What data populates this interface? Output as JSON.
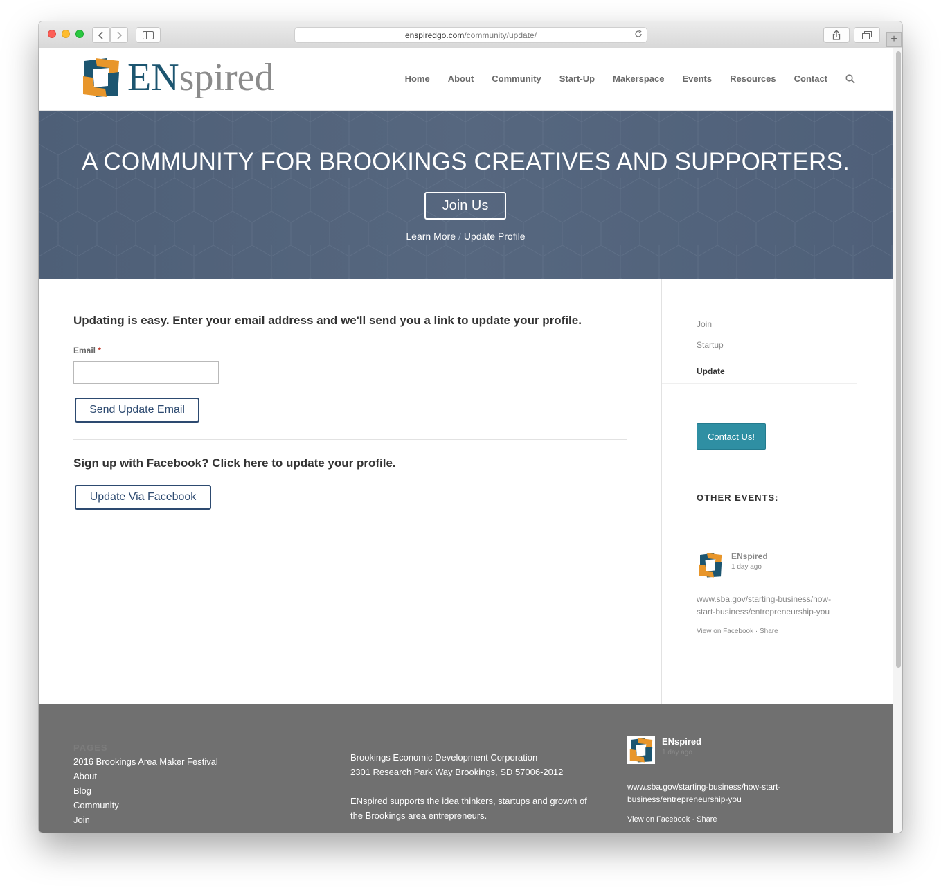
{
  "browser": {
    "url_domain": "enspiredgo.com",
    "url_path": "/community/update/"
  },
  "header": {
    "logo_en": "EN",
    "logo_rest": "spired",
    "nav": [
      "Home",
      "About",
      "Community",
      "Start-Up",
      "Makerspace",
      "Events",
      "Resources",
      "Contact"
    ]
  },
  "hero": {
    "title": "A COMMUNITY FOR BROOKINGS CREATIVES AND SUPPORTERS.",
    "join_button": "Join Us",
    "learn_more": "Learn More",
    "separator": "/",
    "update_profile": "Update Profile"
  },
  "main": {
    "intro": "Updating is easy. Enter your email address and we'll send you a link to update your profile.",
    "email_label": "Email",
    "required_mark": "*",
    "email_value": "",
    "send_button": "Send Update Email",
    "facebook_heading": "Sign up with Facebook? Click here to update your profile.",
    "facebook_button": "Update Via Facebook"
  },
  "sidebar": {
    "nav": [
      "Join",
      "Startup",
      "Update"
    ],
    "active": "Update",
    "contact_button": "Contact Us!",
    "other_events_heading": "OTHER EVENTS:",
    "post": {
      "name": "ENspired",
      "time": "1 day ago",
      "link": "www.sba.gov/starting-business/how-start-business/entrepreneurship-you",
      "view": "View on Facebook",
      "dot": "·",
      "share": "Share"
    }
  },
  "footer": {
    "pages_heading": "PAGES",
    "pages": [
      "2016 Brookings Area Maker Festival",
      "About",
      "Blog",
      "Community",
      "Join"
    ],
    "org_line1": "Brookings Economic Development Corporation",
    "org_line2": "2301 Research Park Way Brookings, SD 57006-2012",
    "about_text": "ENspired supports the idea thinkers, startups and growth of the Brookings area entrepreneurs.",
    "post": {
      "name": "ENspired",
      "time": "1 day ago",
      "link": "www.sba.gov/starting-business/how-start-business/entrepreneurship-you",
      "view": "View on Facebook",
      "dot": "·",
      "share": "Share"
    }
  },
  "colors": {
    "brand_teal": "#1c5570",
    "brand_orange": "#e8962b",
    "hero_bg": "#526279",
    "button_navy": "#2d4a70",
    "contact_teal": "#2f8fa3",
    "footer_bg": "#707070"
  },
  "icons": {
    "logo": "enspired-knot-logo-icon",
    "search": "search-icon",
    "back": "chevron-left-icon",
    "forward": "chevron-right-icon",
    "sidebar": "sidebar-icon",
    "reload": "reload-icon",
    "share": "share-icon",
    "tabs": "tabs-icon",
    "new_tab": "plus-icon"
  }
}
